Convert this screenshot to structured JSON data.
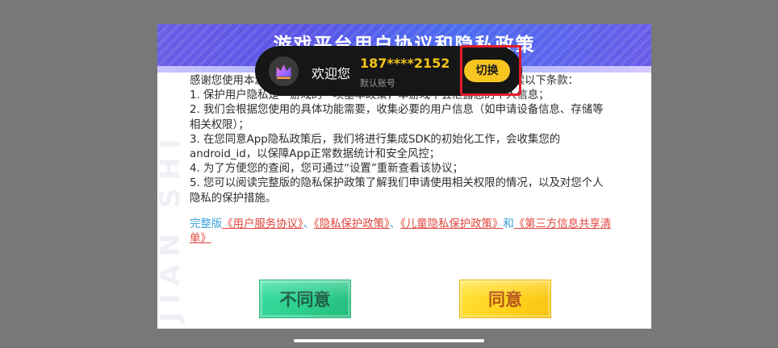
{
  "dialog": {
    "title": "游戏平台用户协议和隐私政策",
    "watermark": "JIAN SHI",
    "paragraphs": [
      "感谢您使用本游戏，为了更好地保障您的权益，请您在使用前仔细阅读以下条款：",
      "1. 保护用户隐私是一游戏的一项基本政策，本游戏不会泄露您的个人信息；",
      "2. 我们会根据您使用的具体功能需要，收集必要的用户信息（如申请设备信息、存储等相关权限）；",
      "3. 在您同意App隐私政策后，我们将进行集成SDK的初始化工作，会收集您的android_id，以保障App正常数据统计和安全风控；",
      "4. 为了方便您的查阅，您可通过“设置”重新查看该协议；",
      "5. 您可以阅读完整版的隐私保护政策了解我们申请使用相关权限的情况，以及对您个人隐私的保护措施。"
    ],
    "links": {
      "prefix": "完整版",
      "user_service": "《用户服务协议》",
      "sep1": "、",
      "privacy": "《隐私保护政策》",
      "sep2": "、",
      "children_privacy": "《儿童隐私保护政策》",
      "and": "和",
      "third_party": "《第三方信息共享清单》"
    },
    "buttons": {
      "disagree": "不同意",
      "agree": "同意"
    }
  },
  "toast": {
    "welcome": "欢迎您",
    "phone": "187****2152",
    "account_label": "默认账号",
    "switch_label": "切换",
    "avatar_icon": "crown-icon"
  },
  "colors": {
    "header_gradient_start": "#6a5ee6",
    "header_gradient_end": "#4b6cf0",
    "link_red": "#e0453c",
    "link_blue": "#3aa0d8",
    "disagree_green": "#2ccd8c",
    "agree_yellow": "#ffd21c",
    "phone_gold": "#f5c518",
    "highlight_red": "#e21b2a"
  }
}
